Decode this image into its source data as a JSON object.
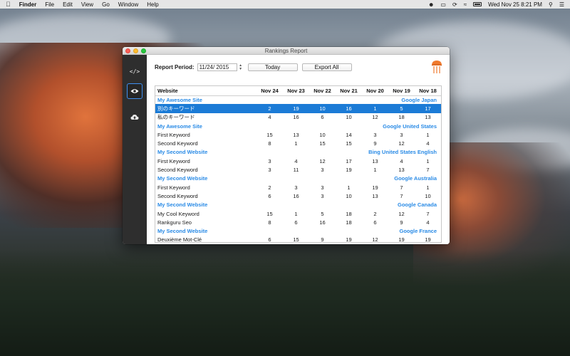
{
  "menubar": {
    "app_name": "Finder",
    "menus": [
      "File",
      "Edit",
      "View",
      "Go",
      "Window",
      "Help"
    ],
    "clock": "Wed Nov 25  8:21 PM"
  },
  "window": {
    "title": "Rankings Report"
  },
  "toolbar": {
    "period_label": "Report Period:",
    "date_value": "11/24/ 2015",
    "today_label": "Today",
    "export_label": "Export All"
  },
  "table": {
    "headers": [
      "Website",
      "Nov 24",
      "Nov 23",
      "Nov 22",
      "Nov 21",
      "Nov 20",
      "Nov 19",
      "Nov 18"
    ],
    "groups": [
      {
        "site": "My Awesome Site",
        "engine": "Google Japan",
        "rows": [
          {
            "keyword": "別のキーワード",
            "values": [
              "2",
              "19",
              "10",
              "16",
              "1",
              "5",
              "17"
            ],
            "selected": true
          },
          {
            "keyword": "私のキーワード",
            "values": [
              "4",
              "16",
              "6",
              "10",
              "12",
              "18",
              "13"
            ]
          }
        ]
      },
      {
        "site": "My Awesome Site",
        "engine": "Google United States",
        "rows": [
          {
            "keyword": "First Keyword",
            "values": [
              "15",
              "13",
              "10",
              "14",
              "3",
              "3",
              "1"
            ]
          },
          {
            "keyword": "Second Keyword",
            "values": [
              "8",
              "1",
              "15",
              "15",
              "9",
              "12",
              "4"
            ]
          }
        ]
      },
      {
        "site": "My Second Website",
        "engine": "Bing United States English",
        "rows": [
          {
            "keyword": "First Keyword",
            "values": [
              "3",
              "4",
              "12",
              "17",
              "13",
              "4",
              "1"
            ]
          },
          {
            "keyword": "Second Keyword",
            "values": [
              "3",
              "11",
              "3",
              "19",
              "1",
              "13",
              "7"
            ]
          }
        ]
      },
      {
        "site": "My Second Website",
        "engine": "Google Australia",
        "rows": [
          {
            "keyword": "First Keyword",
            "values": [
              "2",
              "3",
              "3",
              "1",
              "19",
              "7",
              "1"
            ]
          },
          {
            "keyword": "Second Keyword",
            "values": [
              "6",
              "16",
              "3",
              "10",
              "13",
              "7",
              "10"
            ]
          }
        ]
      },
      {
        "site": "My Second Website",
        "engine": "Google Canada",
        "rows": [
          {
            "keyword": "My Cool Keyword",
            "values": [
              "15",
              "1",
              "5",
              "18",
              "2",
              "12",
              "7"
            ]
          },
          {
            "keyword": "Rankguru Seo",
            "values": [
              "8",
              "6",
              "16",
              "18",
              "6",
              "9",
              "4"
            ]
          }
        ]
      },
      {
        "site": "My Second Website",
        "engine": "Google France",
        "rows": [
          {
            "keyword": "Deuxième Mot-Clé",
            "values": [
              "6",
              "15",
              "9",
              "19",
              "12",
              "19",
              "19"
            ]
          }
        ]
      }
    ]
  },
  "sidebar": {
    "items": [
      {
        "icon": "code-icon",
        "active": false
      },
      {
        "icon": "eye-icon",
        "active": true
      },
      {
        "icon": "cloud-upload-icon",
        "active": false
      }
    ]
  },
  "colors": {
    "accent": "#1b7bd6",
    "group_text": "#2a8be6",
    "sidebar_bg": "#2e2e2e"
  }
}
